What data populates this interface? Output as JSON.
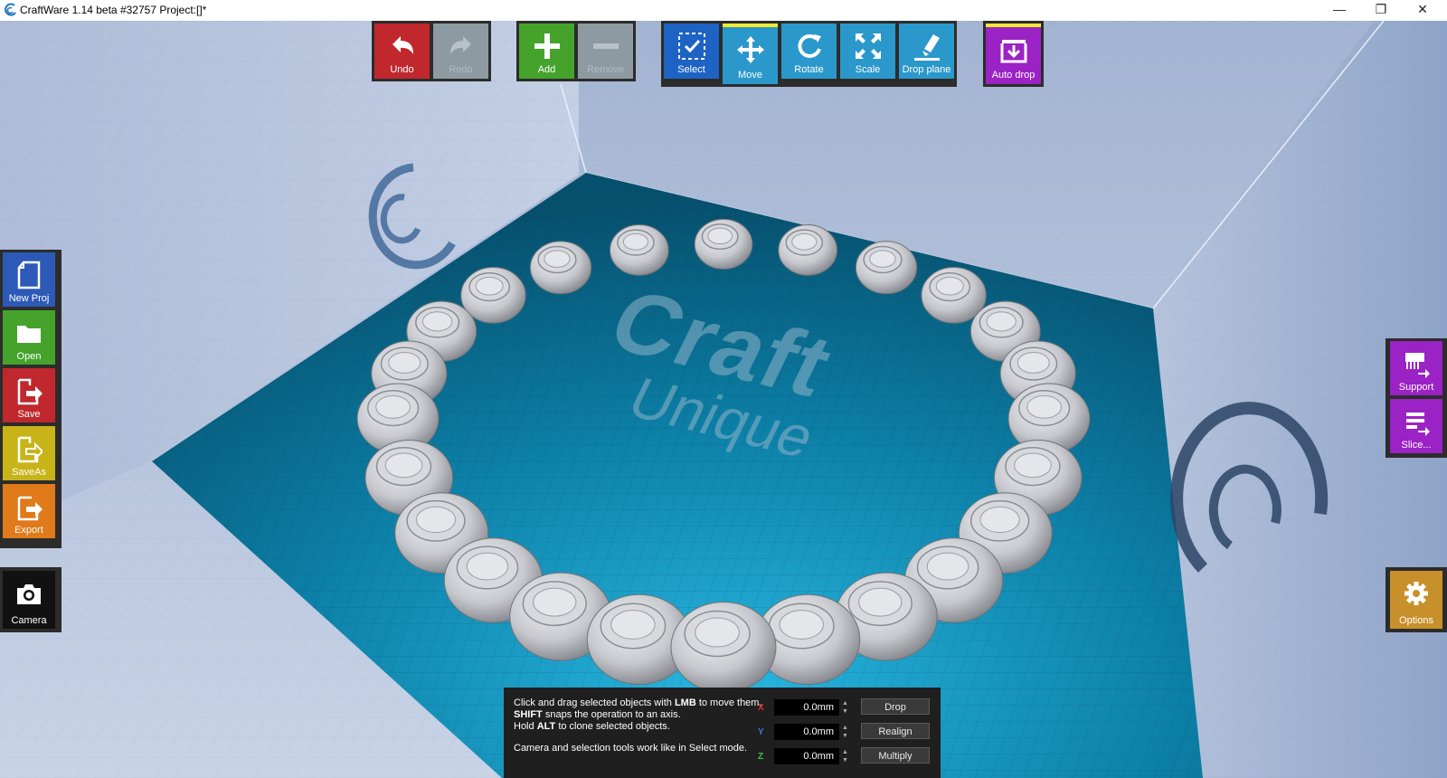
{
  "window": {
    "title": "CraftWare 1.14 beta #32757   Project:[]*",
    "minimize": "—",
    "restore": "❐",
    "close": "✕"
  },
  "toolbar": {
    "undo": "Undo",
    "redo": "Redo",
    "add": "Add",
    "remove": "Remove",
    "select": "Select",
    "move": "Move",
    "rotate": "Rotate",
    "scale": "Scale",
    "drop_plane": "Drop plane",
    "auto_drop": "Auto drop"
  },
  "left_panel": {
    "new_proj": "New Proj",
    "open": "Open",
    "save": "Save",
    "save_as": "SaveAs",
    "export": "Export",
    "camera": "Camera"
  },
  "right_panel": {
    "support": "Support",
    "slice": "Slice...",
    "options": "Options"
  },
  "bed_logo": {
    "text": "Craft",
    "subtext": "Unique"
  },
  "move_panel": {
    "hint_line1_a": "Click and drag selected objects with ",
    "hint_line1_b": "LMB",
    "hint_line1_c": " to move them.",
    "hint_line2_a": "SHIFT",
    "hint_line2_b": " snaps the operation to an axis.",
    "hint_line3_a": "Hold ",
    "hint_line3_b": "ALT",
    "hint_line3_c": " to clone selected objects.",
    "hint_line4": "Camera and selection tools work like in Select mode.",
    "x_label": "X",
    "y_label": "Y",
    "z_label": "Z",
    "x_value": "0.0mm",
    "y_value": "0.0mm",
    "z_value": "0.0mm",
    "drop": "Drop",
    "realign": "Realign",
    "multiply": "Multiply"
  },
  "colors": {
    "undo_red": "#c0282d",
    "add_green": "#45a32c",
    "select_blue": "#1d63c4",
    "tool_blue": "#2b98cc",
    "accent_purple": "#9b22c4",
    "save_as_yellow": "#c8b419",
    "export_orange": "#e07a1a",
    "options_gold": "#c8902a",
    "bed_teal": "#0e6c8e"
  },
  "icons": [
    "app-icon",
    "undo-icon",
    "redo-icon",
    "plus-icon",
    "minus-icon",
    "select-icon",
    "move-icon",
    "rotate-icon",
    "scale-icon",
    "drop-plane-icon",
    "auto-drop-icon",
    "new-file-icon",
    "folder-icon",
    "save-icon",
    "save-as-icon",
    "export-icon",
    "camera-icon",
    "support-icon",
    "slice-icon",
    "gear-icon"
  ]
}
